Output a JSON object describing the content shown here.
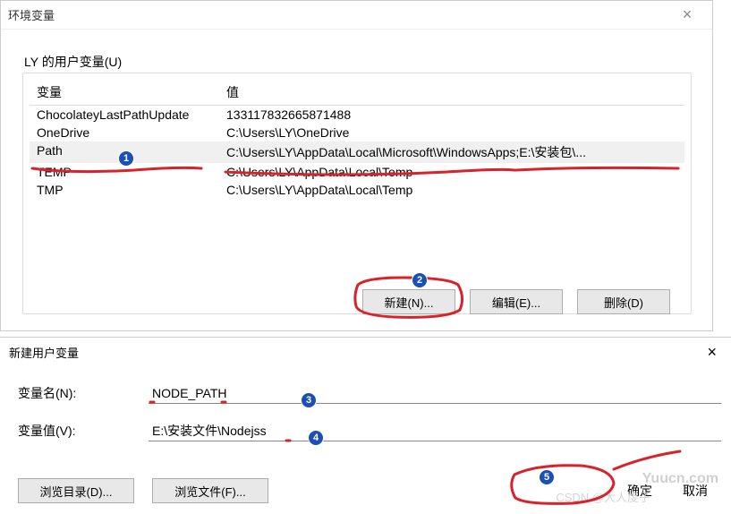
{
  "dialog1": {
    "title": "环境变量",
    "close": "×",
    "group_label": "LY 的用户变量(U)",
    "headers": {
      "var": "变量",
      "val": "值"
    },
    "rows": [
      {
        "var": "ChocolateyLastPathUpdate",
        "val": "133117832665871488"
      },
      {
        "var": "OneDrive",
        "val": "C:\\Users\\LY\\OneDrive"
      },
      {
        "var": "Path",
        "val": "C:\\Users\\LY\\AppData\\Local\\Microsoft\\WindowsApps;E:\\安装包\\..."
      },
      {
        "var": "TEMP",
        "val": "C:\\Users\\LY\\AppData\\Local\\Temp"
      },
      {
        "var": "TMP",
        "val": "C:\\Users\\LY\\AppData\\Local\\Temp"
      }
    ],
    "buttons": {
      "new": "新建(N)...",
      "edit": "编辑(E)...",
      "delete": "删除(D)"
    }
  },
  "dialog2": {
    "title": "新建用户变量",
    "close": "×",
    "name_label": "变量名(N):",
    "name_value": "NODE_PATH",
    "value_label": "变量值(V):",
    "value_value": "E:\\安装文件\\Nodejss",
    "browse_dir": "浏览目录(D)...",
    "browse_file": "浏览文件(F)...",
    "ok": "确定",
    "cancel": "取消"
  },
  "badges": {
    "b1": "1",
    "b2": "2",
    "b3": "3",
    "b4": "4",
    "b5": "5"
  },
  "watermark1": "Yuucn.com",
  "watermark2": "CSDN @大人虔子"
}
